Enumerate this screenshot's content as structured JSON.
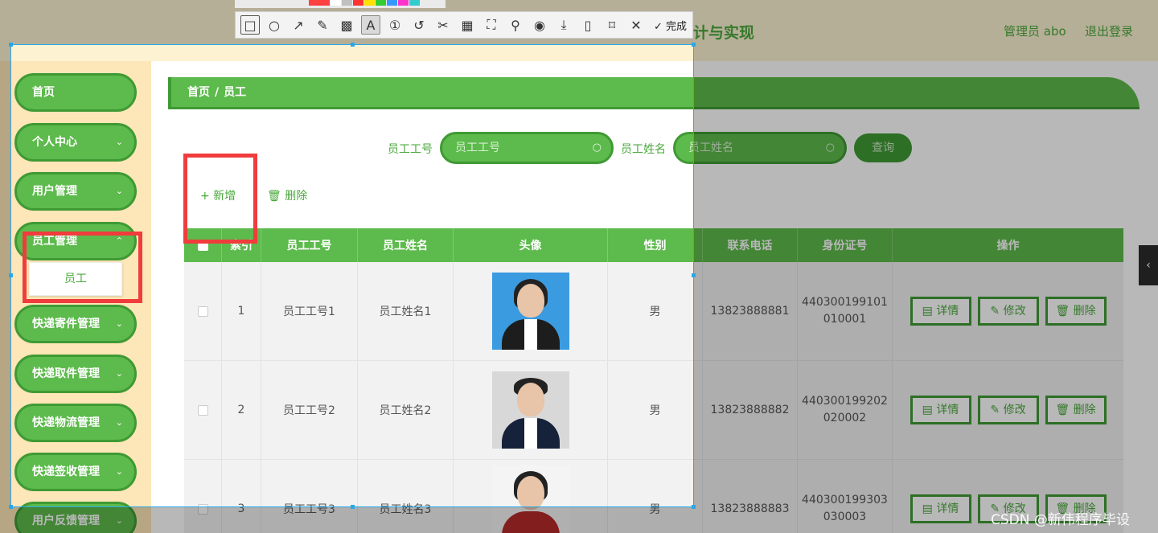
{
  "header": {
    "title_fragment": "计与实现",
    "admin_label": "管理员 abo",
    "logout": "退出登录"
  },
  "sidebar": {
    "items": [
      {
        "label": "首页",
        "chevron": ""
      },
      {
        "label": "个人中心",
        "chevron": "⌄"
      },
      {
        "label": "用户管理",
        "chevron": "⌄"
      },
      {
        "label": "员工管理",
        "chevron": "⌃"
      },
      {
        "label": "快递寄件管理",
        "chevron": "⌄"
      },
      {
        "label": "快递取件管理",
        "chevron": "⌄"
      },
      {
        "label": "快递物流管理",
        "chevron": "⌄"
      },
      {
        "label": "快递签收管理",
        "chevron": "⌄"
      },
      {
        "label": "用户反馈管理",
        "chevron": "⌄"
      }
    ],
    "submenu_item": "员工"
  },
  "breadcrumb": {
    "home": "首页",
    "sep": "/",
    "current": "员工"
  },
  "search": {
    "label1": "员工工号",
    "placeholder1": "员工工号",
    "label2": "员工姓名",
    "placeholder2": "员工姓名",
    "query_button": "查询"
  },
  "actions": {
    "add": "+ 新增",
    "delete": "🗑 删除"
  },
  "table": {
    "headers": [
      "",
      "索引",
      "员工工号",
      "员工姓名",
      "头像",
      "性别",
      "联系电话",
      "身份证号",
      "操作"
    ],
    "rows": [
      {
        "index": "1",
        "emp_no": "员工工号1",
        "name": "员工姓名1",
        "gender": "男",
        "phone": "13823888881",
        "id_line1": "440300199101",
        "id_line2": "010001"
      },
      {
        "index": "2",
        "emp_no": "员工工号2",
        "name": "员工姓名2",
        "gender": "男",
        "phone": "13823888882",
        "id_line1": "440300199202",
        "id_line2": "020002"
      },
      {
        "index": "3",
        "emp_no": "员工工号3",
        "name": "员工姓名3",
        "gender": "男",
        "phone": "13823888883",
        "id_line1": "440300199303",
        "id_line2": "030003"
      }
    ],
    "op_labels": {
      "detail": "▤ 详情",
      "edit": "✎ 修改",
      "delete": "🗑 删除"
    }
  },
  "collapse_tab": "‹",
  "screenshot_tool": {
    "tools": [
      "rectangle-icon",
      "ellipse-icon",
      "arrow-icon",
      "pencil-icon",
      "mosaic-icon",
      "text-icon",
      "number-icon",
      "undo-icon",
      "scissors-icon",
      "ocr-icon",
      "screen-capture-icon",
      "pin-icon",
      "record-icon",
      "download-icon",
      "phone-icon",
      "bookmark-icon",
      "close-icon"
    ],
    "done_label": "✓ 完成",
    "swatches": [
      "#ff4040",
      "#ffffff",
      "#c0c0c0",
      "#ff3333",
      "#ffe000",
      "#33cc33",
      "#3399ff",
      "#ff33cc",
      "#33cccc"
    ]
  },
  "watermark": "CSDN @新伟程序毕设"
}
